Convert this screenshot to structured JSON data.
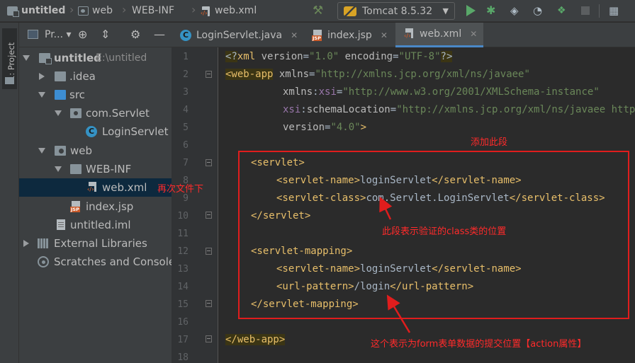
{
  "breadcrumb": {
    "items": [
      "untitled",
      "web",
      "WEB-INF",
      "web.xml"
    ]
  },
  "toolbar": {
    "run_config": "Tomcat 8.5.32",
    "icons": [
      "hammer-icon",
      "run-icon",
      "debug-icon",
      "coverage-icon",
      "profile-icon",
      "attach-debugger-icon",
      "stop-icon",
      "project-structure-icon"
    ]
  },
  "toolstrip": {
    "project_tab_label": "1: Project"
  },
  "project_panel": {
    "title": "Pr...",
    "tree": [
      {
        "label": "untitled",
        "path": "E:\\untitled",
        "icon": "module-folder-icon"
      },
      {
        "label": ".idea",
        "icon": "folder-icon"
      },
      {
        "label": "src",
        "icon": "source-folder-icon"
      },
      {
        "label": "com.Servlet",
        "icon": "package-icon"
      },
      {
        "label": "LoginServlet",
        "icon": "class-icon"
      },
      {
        "label": "web",
        "icon": "web-folder-icon"
      },
      {
        "label": "WEB-INF",
        "icon": "folder-icon"
      },
      {
        "label": "web.xml",
        "icon": "xml-file-icon"
      },
      {
        "label": "index.jsp",
        "icon": "jsp-file-icon"
      },
      {
        "label": "untitled.iml",
        "icon": "iml-file-icon"
      },
      {
        "label": "External Libraries",
        "icon": "libraries-icon"
      },
      {
        "label": "Scratches and Consoles",
        "icon": "scratches-icon"
      }
    ]
  },
  "editor": {
    "tabs": [
      {
        "label": "LoginServlet.java"
      },
      {
        "label": "index.jsp"
      },
      {
        "label": "web.xml",
        "active": true
      }
    ],
    "line_numbers": [
      "1",
      "2",
      "3",
      "4",
      "5",
      "6",
      "7",
      "8",
      "9",
      "10",
      "11",
      "12",
      "13",
      "14",
      "15",
      "16",
      "17",
      "18"
    ]
  },
  "annotations": {
    "add_this_section": "添加此段",
    "subfolder_note": "再次文件下",
    "class_location_note": "此段表示验证的class类的位置",
    "action_note": "这个表示为form表单数据的提交位置【action属性】"
  },
  "colors": {
    "annotation_red": "#e01d1d",
    "xml_tag": "#e8bf6a",
    "xml_string": "#6a8759",
    "xml_namespace": "#9876aa",
    "selection": "#0d293e",
    "active_tab_underline": "#4a88c7"
  }
}
